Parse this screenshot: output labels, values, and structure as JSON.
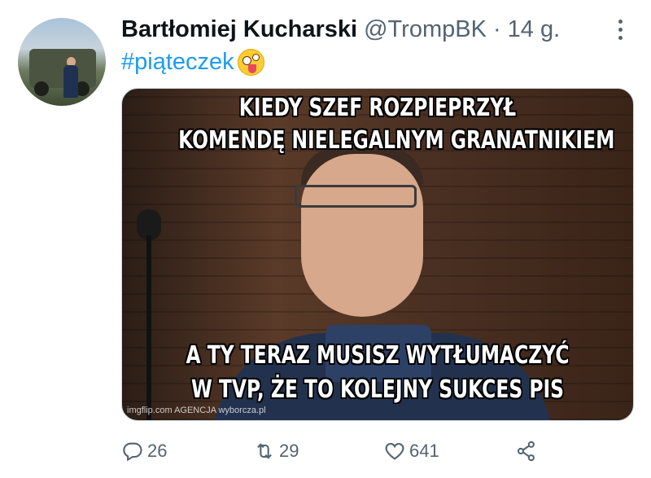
{
  "tweet": {
    "author_name": "Bartłomiej Kucharski",
    "handle": "@TrompBK",
    "separator": "·",
    "time": "14 g.",
    "hashtag": "#piąteczek"
  },
  "media": {
    "line1": "KIEDY SZEF ROZPIEPRZYŁ",
    "line2": "KOMENDĘ NIELEGALNYM GRANATNIKIEM",
    "line3": "A TY TERAZ MUSISZ WYTŁUMACZYĆ",
    "line4": "W TVP, ŻE TO KOLEJNY SUKCES PIS",
    "watermark": "imgflip.com AGENCJA wyborcza.pl"
  },
  "actions": {
    "replies": "26",
    "retweets": "29",
    "likes": "641"
  },
  "icons": {
    "reply": "reply-icon",
    "retweet": "retweet-icon",
    "like": "heart-icon",
    "share": "share-icon",
    "more": "more-icon",
    "emoji": "zany-face-emoji-icon"
  },
  "colors": {
    "link": "#1d9bf0",
    "secondary_text": "#536471",
    "primary_text": "#0f1419"
  }
}
